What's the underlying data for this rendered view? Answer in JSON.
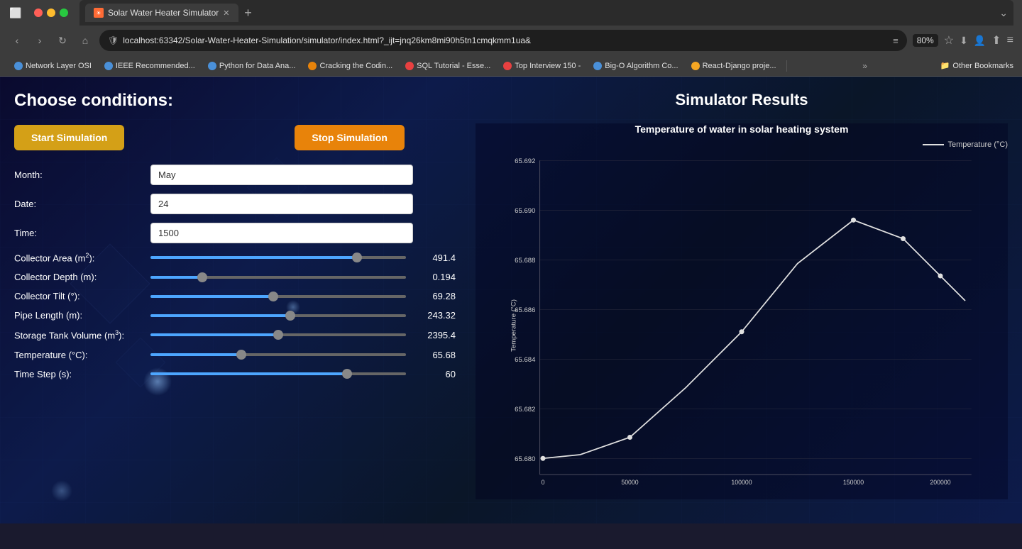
{
  "browser": {
    "tab_title": "Solar Water Heater Simulator",
    "url": "localhost:63342/Solar-Water-Heater-Simulation/simulator/index.html?_ijt=jnq26km8mi90h5tn1cmqkmm1ua&",
    "zoom": "80%",
    "bookmarks": [
      {
        "label": "Network Layer OSI",
        "icon_type": "blue"
      },
      {
        "label": "IEEE Recommended...",
        "icon_type": "blue"
      },
      {
        "label": "Python for Data Ana...",
        "icon_type": "blue"
      },
      {
        "label": "Cracking the Codin...",
        "icon_type": "orange"
      },
      {
        "label": "SQL Tutorial - Esse...",
        "icon_type": "green"
      },
      {
        "label": "Top Interview 150 -",
        "icon_type": "red"
      },
      {
        "label": "Big-O Algorithm Co...",
        "icon_type": "blue"
      },
      {
        "label": "React-Django proje...",
        "icon_type": "yellow"
      }
    ],
    "other_bookmarks": "Other Bookmarks"
  },
  "app": {
    "title": "Solar Water Heater Simulator",
    "choose_conditions": "Choose conditions:",
    "start_button": "Start Simulation",
    "stop_button": "Stop Simulation",
    "simulator_results": "Simulator Results",
    "chart_title": "Temperature of water in solar heating system",
    "legend_label": "Temperature (°C)"
  },
  "form": {
    "month_label": "Month:",
    "month_value": "May",
    "date_label": "Date:",
    "date_value": "24",
    "time_label": "Time:",
    "time_value": "1500",
    "collector_area_label": "Collector Area (m²):",
    "collector_area_value": "491.4",
    "collector_area_pct": "82",
    "collector_depth_label": "Collector Depth (m):",
    "collector_depth_value": "0.194",
    "collector_depth_pct": "19",
    "collector_tilt_label": "Collector Tilt (°):",
    "collector_tilt_value": "69.28",
    "collector_tilt_pct": "48",
    "pipe_length_label": "Pipe Length (m):",
    "pipe_length_value": "243.32",
    "pipe_length_pct": "55",
    "storage_tank_label": "Storage Tank Volume (m³):",
    "storage_tank_value": "2395.4",
    "storage_tank_pct": "50",
    "temperature_label": "Temperature (°C):",
    "temperature_value": "65.68",
    "temperature_pct": "35",
    "time_step_label": "Time Step (s):",
    "time_step_value": "60",
    "time_step_pct": "78"
  },
  "chart": {
    "y_axis_label": "Temperature (°C)",
    "y_values": [
      "65.692",
      "65.690",
      "65.688",
      "65.686",
      "65.684",
      "65.682",
      "65.680"
    ],
    "data_points": [
      {
        "x": 0.02,
        "y": 0.97
      },
      {
        "x": 0.15,
        "y": 0.97
      },
      {
        "x": 0.3,
        "y": 0.85
      },
      {
        "x": 0.5,
        "y": 0.6
      },
      {
        "x": 0.65,
        "y": 0.4
      },
      {
        "x": 0.8,
        "y": 0.15
      },
      {
        "x": 0.9,
        "y": 0.08
      }
    ]
  }
}
